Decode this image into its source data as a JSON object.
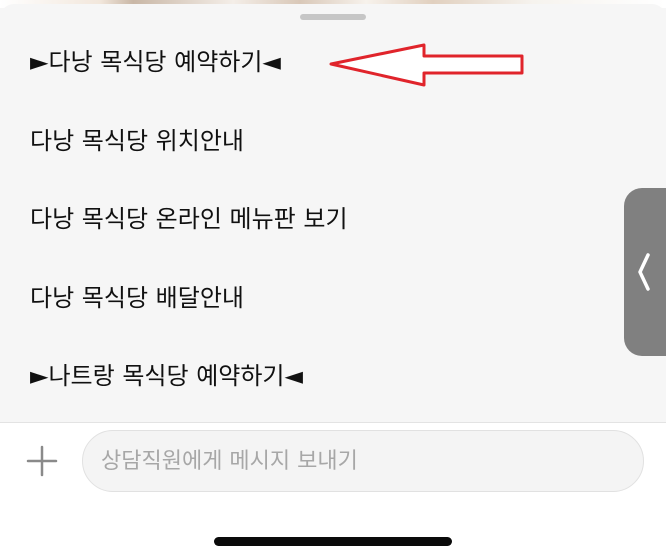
{
  "menu": {
    "items": [
      {
        "label": "►다낭 목식당 예약하기◄"
      },
      {
        "label": "다낭 목식당 위치안내"
      },
      {
        "label": "다낭 목식당 온라인 메뉴판 보기"
      },
      {
        "label": "다낭 목식당 배달안내"
      },
      {
        "label": "►나트랑 목식당 예약하기◄"
      }
    ]
  },
  "annotation": {
    "arrow_icon": "outline-arrow-left-icon",
    "color": "#e0242b"
  },
  "side_tab": {
    "icon": "chevron-left-icon"
  },
  "composer": {
    "add_icon": "plus-icon",
    "placeholder": "상담직원에게 메시지 보내기",
    "value": ""
  },
  "colors": {
    "sheet_background": "#f6f6f6",
    "text": "#111111",
    "side_tab": "#808080",
    "annotation_arrow": "#e0242b"
  }
}
